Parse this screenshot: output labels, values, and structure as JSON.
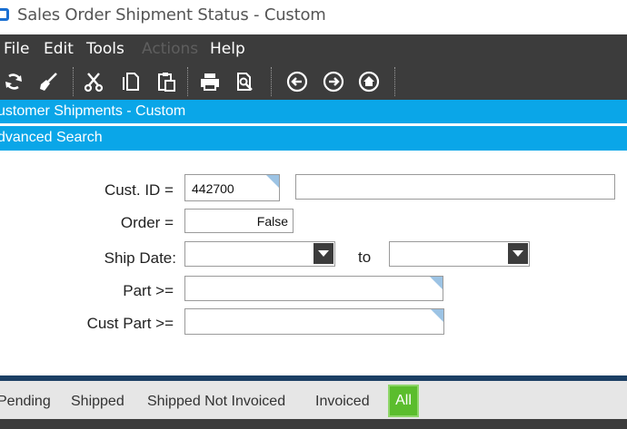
{
  "window": {
    "title": "Sales Order Shipment Status - Custom"
  },
  "menu": {
    "items": [
      {
        "label": "File",
        "enabled": true
      },
      {
        "label": "Edit",
        "enabled": true
      },
      {
        "label": "Tools",
        "enabled": true
      },
      {
        "label": "Actions",
        "enabled": false
      },
      {
        "label": "Help",
        "enabled": true
      }
    ]
  },
  "toolbar": {
    "icons": [
      "refresh-icon",
      "clear-icon",
      "cut-icon",
      "copy-icon",
      "paste-icon",
      "print-icon",
      "print-preview-icon",
      "back-icon",
      "forward-icon",
      "home-icon"
    ]
  },
  "sections": {
    "header_title": "ustomer Shipments - Custom",
    "advanced_search": "dvanced Search"
  },
  "form": {
    "cust_id_label": "Cust. ID =",
    "cust_id_value": "442700",
    "cust_name_value": "",
    "order_label": "Order =",
    "order_value": "False",
    "ship_date_label": "Ship Date:",
    "ship_date_from": "",
    "to_label": "to",
    "ship_date_to": "",
    "part_label": "Part >=",
    "part_value": "",
    "cust_part_label": "Cust Part >=",
    "cust_part_value": ""
  },
  "filters": {
    "items": [
      "Pending",
      "Shipped",
      "Shipped Not Invoiced",
      "Invoiced"
    ],
    "selected": "All"
  },
  "colors": {
    "section_bar": "#0aa6e8",
    "menubar": "#3c3c3c",
    "selected_filter": "#5bbd2d",
    "field_corner": "#9cc3e4"
  }
}
